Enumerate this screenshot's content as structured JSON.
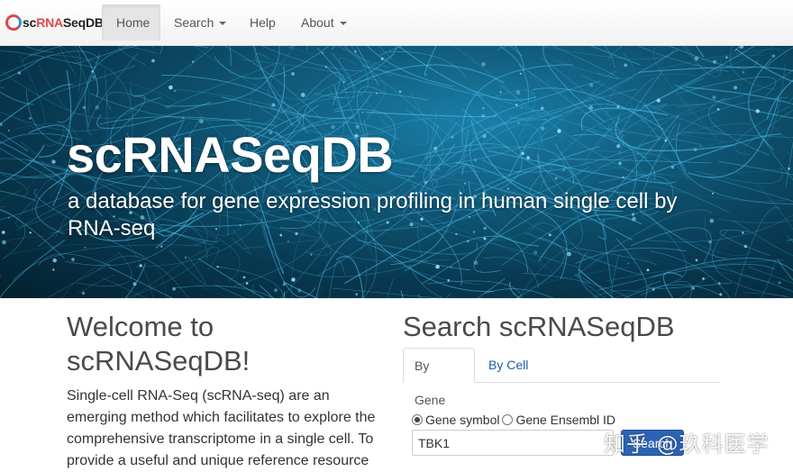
{
  "navbar": {
    "brand": {
      "prefix": "sc",
      "mid": "RNA",
      "suffix": "SeqDB"
    },
    "items": [
      {
        "label": "Home",
        "active": true
      },
      {
        "label": "Search",
        "dropdown": true
      },
      {
        "label": "Help"
      },
      {
        "label": "About",
        "dropdown": true
      }
    ]
  },
  "hero": {
    "title": "scRNASeqDB",
    "subtitle": "a database for gene expression profiling in human single cell by RNA-seq"
  },
  "welcome": {
    "title": "Welcome to scRNASeqDB!",
    "body": "Single-cell RNA-Seq (scRNA-seq) are an emerging method which facilitates to explore the comprehensive transcriptome in a single cell. To provide a useful and unique reference resource"
  },
  "search": {
    "title": "Search scRNASeqDB",
    "tabs": [
      {
        "label": "By Gene",
        "active": true
      },
      {
        "label": "By Cell"
      }
    ],
    "radios": [
      {
        "label": "Gene symbol",
        "checked": true
      },
      {
        "label": "Gene Ensembl ID",
        "checked": false
      }
    ],
    "input_value": "TBK1",
    "button_label": "Search"
  },
  "watermark": "知乎 @玖科医学",
  "colors": {
    "accent": "#2c63b5",
    "link": "#1e5ea8",
    "brand_red": "#e0474c"
  }
}
